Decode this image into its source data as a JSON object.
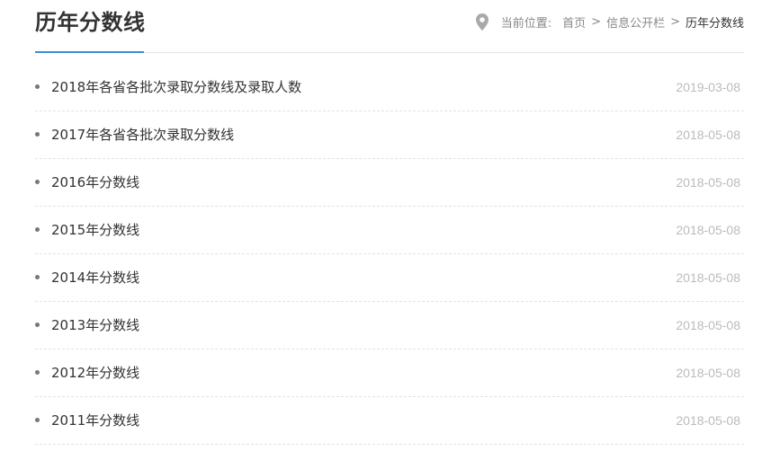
{
  "header": {
    "title": "历年分数线",
    "breadcrumb": {
      "label": "当前位置:",
      "items": [
        "首页",
        "信息公开栏"
      ],
      "separator": ">",
      "current": "历年分数线"
    }
  },
  "colors": {
    "accent": "#3f8ed6",
    "text": "#333333",
    "muted": "#888888",
    "date": "#bbbbbb"
  },
  "icons": {
    "location": "location-pin-icon",
    "bullet": "bullet-dot-icon"
  },
  "items": [
    {
      "title": "2018年各省各批次录取分数线及录取人数",
      "date": "2019-03-08"
    },
    {
      "title": "2017年各省各批次录取分数线",
      "date": "2018-05-08"
    },
    {
      "title": "2016年分数线",
      "date": "2018-05-08"
    },
    {
      "title": "2015年分数线",
      "date": "2018-05-08"
    },
    {
      "title": "2014年分数线",
      "date": "2018-05-08"
    },
    {
      "title": "2013年分数线",
      "date": "2018-05-08"
    },
    {
      "title": "2012年分数线",
      "date": "2018-05-08"
    },
    {
      "title": "2011年分数线",
      "date": "2018-05-08"
    }
  ]
}
